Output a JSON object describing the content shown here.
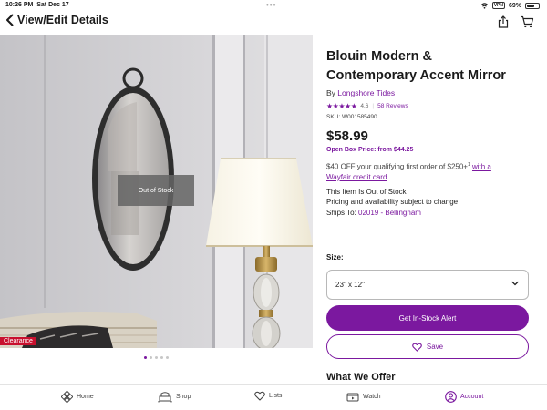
{
  "status_bar": {
    "time": "10:26 PM",
    "date": "Sat Dec 17",
    "dots": "•••",
    "vpn": "VPN",
    "battery": "69%",
    "battery_level": 0.69
  },
  "header": {
    "back_label": "View/Edit Details",
    "icons": [
      "back-chevron-icon",
      "share-icon",
      "cart-icon"
    ]
  },
  "image": {
    "overlay_text": "Out of Stock",
    "badge": "Clearance",
    "carousel": {
      "count": 5,
      "active_index": 0
    }
  },
  "product": {
    "title_line1": "Blouin Modern &",
    "title_line2": "Contemporary Accent Mirror",
    "by_prefix": "By",
    "brand": "Longshore Tides",
    "rating": "4.6",
    "rating_value": 4.6,
    "reviews": "58 Reviews",
    "sku": "SKU: W001585490",
    "price": "$58.99",
    "open_box_label": "Open Box Price: from",
    "open_box_price": "$44.25",
    "promo_text": "$40 OFF your qualifying first order of $250+",
    "promo_sup": "1",
    "promo_link_line1": "with a",
    "promo_link_line2": "Wayfair credit card",
    "stock_status": "This Item Is Out of Stock",
    "stock_note": "Pricing and availability subject to change",
    "ships_to_label": "Ships To:",
    "ships_to_value": "02019 - Bellingham"
  },
  "size": {
    "label": "Size:",
    "selected": "23\" x 12\""
  },
  "actions": {
    "alert_label": "Get In-Stock Alert",
    "save_label": "Save"
  },
  "section_heading": "What We Offer",
  "tabs": [
    {
      "label": "Home",
      "icon": "home-icon",
      "active": false
    },
    {
      "label": "Shop",
      "icon": "shop-icon",
      "active": false
    },
    {
      "label": "Lists",
      "icon": "heart-icon",
      "active": false
    },
    {
      "label": "Watch",
      "icon": "watch-icon",
      "active": false
    },
    {
      "label": "Account",
      "icon": "account-icon",
      "active": true
    }
  ],
  "colors": {
    "accent": "#7b189f",
    "clearance": "#c8102e"
  }
}
